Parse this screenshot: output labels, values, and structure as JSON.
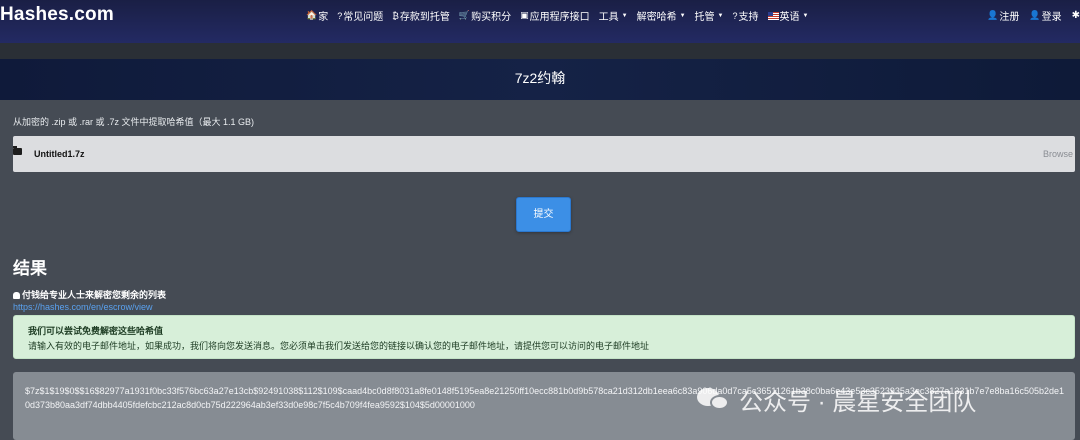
{
  "navbar": {
    "brand": "Hashes.com",
    "items": [
      {
        "icon": "🏠",
        "label": "家",
        "caret": false
      },
      {
        "icon": "?",
        "label": "常见问题",
        "caret": false
      },
      {
        "icon": "₿",
        "label": "存款到托管",
        "caret": false
      },
      {
        "icon": "🛒",
        "label": "购买积分",
        "caret": false
      },
      {
        "icon": "▣",
        "label": "应用程序接口",
        "caret": false
      },
      {
        "icon": "",
        "label": "工具",
        "caret": true
      },
      {
        "icon": "",
        "label": "解密哈希",
        "caret": true
      },
      {
        "icon": "",
        "label": "托管",
        "caret": true
      },
      {
        "icon": "?",
        "label": "支持",
        "caret": false
      },
      {
        "icon": "",
        "label": "英语",
        "caret": true
      }
    ],
    "register": "注册",
    "login": "登录",
    "settings_icon": "✱"
  },
  "title": "7z2约翰",
  "upload": {
    "label": "从加密的 .zip 或 .rar 或 .7z 文件中提取哈希值（最大 1.1 GB)",
    "file_name": "Untitled1.7z",
    "browse": "Browse"
  },
  "submit_label": "提交",
  "results": {
    "heading": "结果",
    "pay_text": "付钱给专业人士来解密您剩余的列表",
    "escrow_link": "https://hashes.com/en/escrow/view",
    "alert_title": "我们可以尝试免费解密这些哈希值",
    "alert_body": "请输入有效的电子邮件地址，如果成功，我们将向您发送消息。您必须单击我们发送给您的链接以确认您的电子邮件地址，请提供您可以访问的电子邮件地址",
    "hash_line1": "$7z$1$19$0$$16$82977a1931f0bc33f576bc63a27e13cb$92491038$112$109$caad4bc0d8f8031a8fe0148f5195ea8e21250ff10ecc881b0d9b578ca21d312db1eea6c83a906da0d7ca5c36511261b38c0ba6e43e53c3523935a3ec3827a1331b7e7e8ba16c505b2de1",
    "hash_line2": "0d373b80aa3df74dbb4405fdefcbc212ac8d0cb75d222964ab3ef33d0e98c7f5c4b709f4fea9592$104$5d00001000"
  },
  "watermark": "公众号 · 晨星安全团队",
  "colors": {
    "background": "#454b54",
    "navbar": "#1a1f45",
    "accent": "#3c8fe6",
    "alert_bg": "#d7efd9",
    "link": "#5aa2f0"
  }
}
